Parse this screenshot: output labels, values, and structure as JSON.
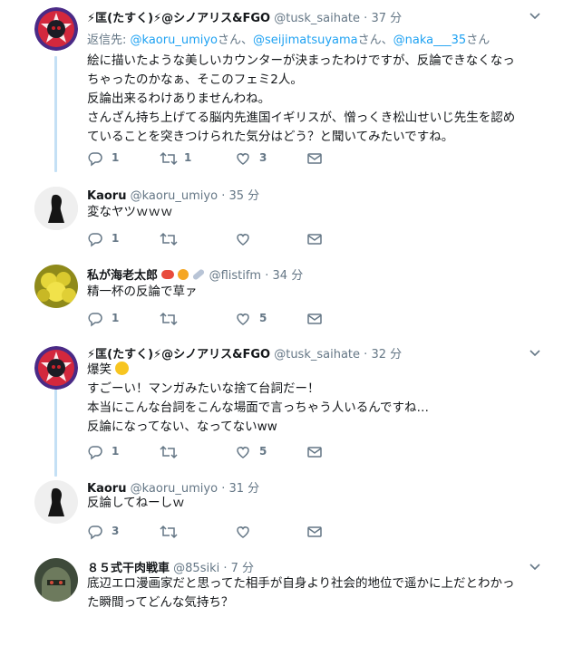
{
  "tweets": [
    {
      "name": "⚡匡(たすく)⚡@シノアリス&FGO",
      "handle": "@tusk_saihate",
      "time": "37 分",
      "reply_prefix": "返信先:",
      "reply_mentions": [
        "@kaoru_umiyo",
        "@seijimatsuyama",
        "@naka___35"
      ],
      "reply_sep": [
        "さん、",
        "さん、",
        "さん"
      ],
      "lines": [
        "絵に描いたような美しいカウンターが決まったわけですが、反論できなくなっ",
        "ちゃったのかなぁ、そこのフェミ2人。",
        "反論出来るわけありませんわね。",
        "さんざん持ち上げてる脳内先進国イギリスが、憎っくき松山せいじ先生を認め",
        "ていることを突きつけられた気分はどう？と聞いてみたいですね。"
      ],
      "replies": "1",
      "retweets": "1",
      "likes": "3"
    },
    {
      "name": "Kaoru",
      "handle": "@kaoru_umiyo",
      "time": "35 分",
      "lines": [
        "変なヤツｗｗｗ"
      ],
      "replies": "1",
      "retweets": "",
      "likes": ""
    },
    {
      "name": "私が海老太郎",
      "handle": "@flistifm",
      "time": "34 分",
      "lines": [
        "精一杯の反論で草ァ"
      ],
      "replies": "1",
      "retweets": "",
      "likes": "5"
    },
    {
      "name": "⚡匡(たすく)⚡@シノアリス&FGO",
      "handle": "@tusk_saihate",
      "time": "32 分",
      "lines": [
        "爆笑",
        "すごーい！マンガみたいな捨て台詞だー！",
        "本当にこんな台詞をこんな場面で言っちゃう人いるんですね…",
        "反論になってない、なってないww"
      ],
      "replies": "1",
      "retweets": "",
      "likes": "5"
    },
    {
      "name": "Kaoru",
      "handle": "@kaoru_umiyo",
      "time": "31 分",
      "lines": [
        "反論してねーしｗ"
      ],
      "replies": "3",
      "retweets": "",
      "likes": ""
    },
    {
      "name": "８５式干肉戦車",
      "handle": "@85siki",
      "time": "7 分",
      "lines": [
        "底辺エロ漫画家だと思ってた相手が自身より社会的地位で遥かに上だとわかっ",
        "た瞬間ってどんな気持ち？"
      ]
    }
  ],
  "sep": "·",
  "colors": {
    "link": "#1da1f2",
    "meta": "#657786",
    "thread_line": "#c4e0f5"
  }
}
